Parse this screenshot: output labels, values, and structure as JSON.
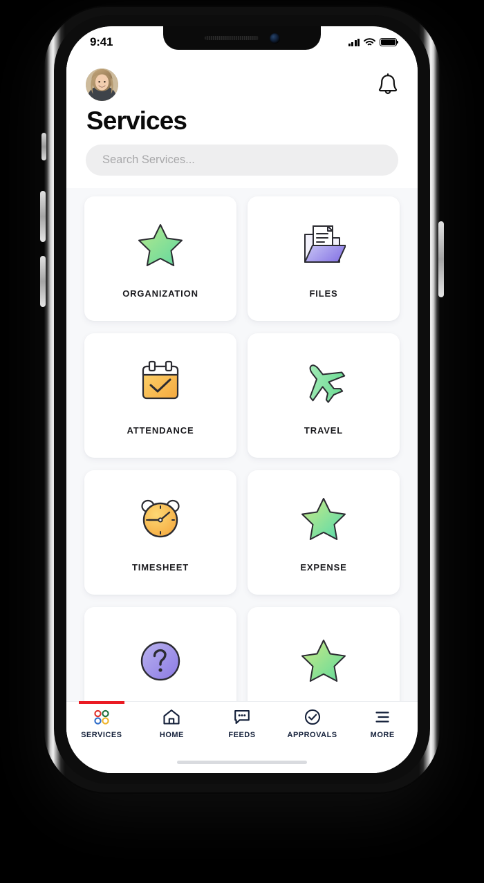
{
  "device": {
    "frame": "iphone-x",
    "notch_icons": [
      "speaker-grille",
      "front-camera"
    ]
  },
  "status_bar": {
    "time": "9:41",
    "icons": [
      "cellular-signal-icon",
      "wifi-icon",
      "battery-icon"
    ],
    "battery_level": 100
  },
  "header": {
    "avatar_name": "user-avatar",
    "notification_icon": "bell-icon",
    "title": "Services"
  },
  "search": {
    "placeholder": "Search Services...",
    "value": ""
  },
  "services": {
    "items": [
      {
        "label": "ORGANIZATION",
        "icon": "star-icon",
        "color": "#7ddc9a"
      },
      {
        "label": "FILES",
        "icon": "folder-document-icon",
        "color": "#9b8ff0"
      },
      {
        "label": "ATTENDANCE",
        "icon": "calendar-check-icon",
        "color": "#fbc85a"
      },
      {
        "label": "TRAVEL",
        "icon": "airplane-icon",
        "color": "#8ee0a4"
      },
      {
        "label": "TIMESHEET",
        "icon": "alarm-clock-icon",
        "color": "#fbc84f"
      },
      {
        "label": "EXPENSE",
        "icon": "star-icon",
        "color": "#7fe0b0"
      },
      {
        "label": "",
        "icon": "question-circle-icon",
        "color": "#9b8ff0"
      },
      {
        "label": "",
        "icon": "star-icon",
        "color": "#8ede92"
      }
    ]
  },
  "tabbar": {
    "active_index": 0,
    "accent_color": "#ea1b23",
    "tabs": [
      {
        "label": "SERVICES",
        "icon": "four-circles-icon"
      },
      {
        "label": "HOME",
        "icon": "house-icon"
      },
      {
        "label": "FEEDS",
        "icon": "chat-bubble-icon"
      },
      {
        "label": "APPROVALS",
        "icon": "check-circle-icon"
      },
      {
        "label": "MORE",
        "icon": "hamburger-menu-icon"
      }
    ]
  },
  "colors": {
    "page_background": "#f7f8fa",
    "card_background": "#ffffff",
    "accent_red": "#ea1b23",
    "text_primary": "#14203a",
    "search_background": "#eeeeef"
  }
}
